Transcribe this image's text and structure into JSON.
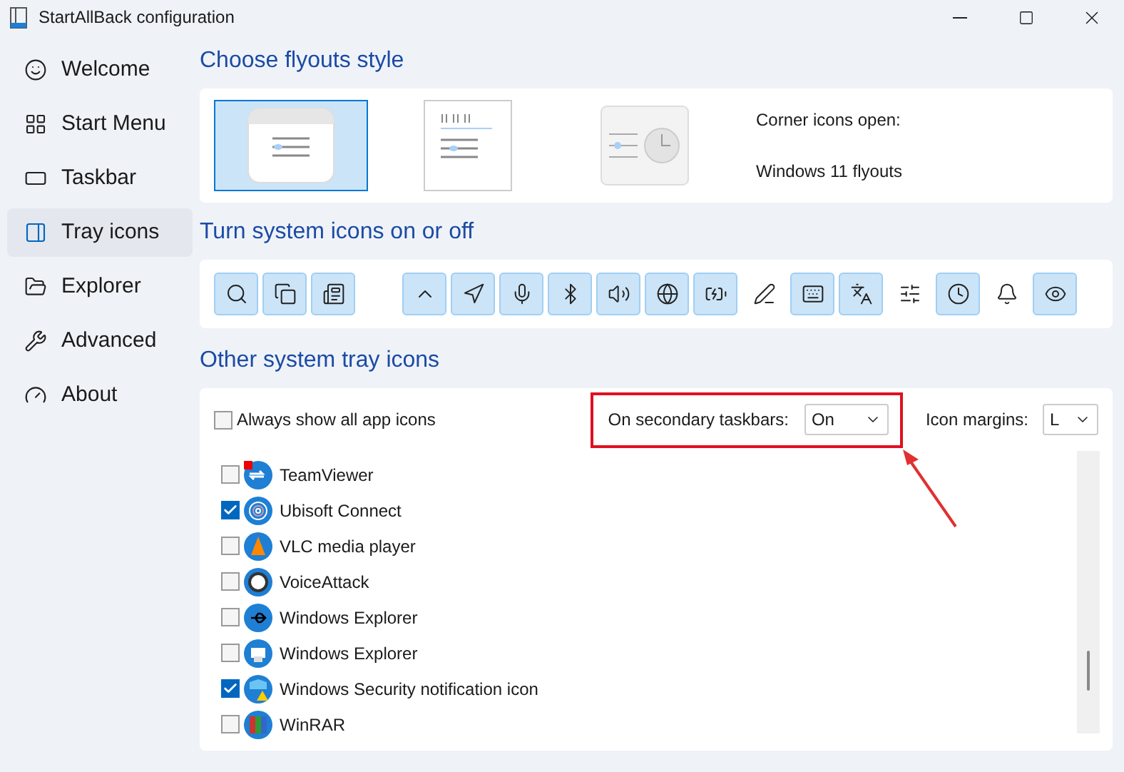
{
  "window": {
    "title": "StartAllBack configuration"
  },
  "sidebar": {
    "items": [
      {
        "label": "Welcome",
        "kind": "smile",
        "selected": false
      },
      {
        "label": "Start Menu",
        "kind": "start",
        "selected": false
      },
      {
        "label": "Taskbar",
        "kind": "taskbar",
        "selected": false
      },
      {
        "label": "Tray icons",
        "kind": "tray",
        "selected": true
      },
      {
        "label": "Explorer",
        "kind": "folder",
        "selected": false
      },
      {
        "label": "Advanced",
        "kind": "wrench",
        "selected": false
      },
      {
        "label": "About",
        "kind": "gauge",
        "selected": false
      }
    ]
  },
  "flyouts": {
    "heading": "Choose flyouts style",
    "styles": [
      {
        "kind": "win11",
        "selected": true
      },
      {
        "kind": "win10",
        "selected": false
      },
      {
        "kind": "win7",
        "selected": false
      }
    ],
    "corner_label": "Corner icons open:",
    "corner_value": "Windows 11 flyouts"
  },
  "system_icons": {
    "heading": "Turn system icons on or off",
    "groups": [
      [
        {
          "kind": "search",
          "on": true
        },
        {
          "kind": "taskview",
          "on": true
        },
        {
          "kind": "widgets",
          "on": true
        }
      ],
      [
        {
          "kind": "chevron",
          "on": true
        },
        {
          "kind": "location",
          "on": true
        },
        {
          "kind": "mic",
          "on": true
        },
        {
          "kind": "bluetooth",
          "on": true
        },
        {
          "kind": "volume",
          "on": true
        },
        {
          "kind": "globe",
          "on": true
        },
        {
          "kind": "battery",
          "on": true
        },
        {
          "kind": "pen",
          "on": false
        },
        {
          "kind": "keyboard",
          "on": true
        },
        {
          "kind": "language",
          "on": true
        },
        {
          "kind": "mixer",
          "on": false
        },
        {
          "kind": "clock",
          "on": true
        },
        {
          "kind": "bell",
          "on": false
        },
        {
          "kind": "eye",
          "on": true
        }
      ]
    ]
  },
  "other_icons": {
    "heading": "Other system tray icons",
    "always_show": {
      "label": "Always show all app icons",
      "checked": false
    },
    "secondary": {
      "label": "On secondary taskbars:",
      "value": "On"
    },
    "margins": {
      "label": "Icon margins:",
      "value": "L"
    },
    "apps": [
      {
        "name": "TeamViewer",
        "kind": "arrows",
        "checked": false
      },
      {
        "name": "Ubisoft Connect",
        "kind": "rings",
        "checked": true
      },
      {
        "name": "VLC media player",
        "kind": "cone",
        "checked": false
      },
      {
        "name": "VoiceAttack",
        "kind": "gear",
        "checked": false
      },
      {
        "name": "Windows Explorer",
        "kind": "usb",
        "checked": false
      },
      {
        "name": "Windows Explorer",
        "kind": "printer",
        "checked": false
      },
      {
        "name": "Windows Security notification icon",
        "kind": "shield",
        "checked": true
      },
      {
        "name": "WinRAR",
        "kind": "books",
        "checked": false
      }
    ]
  }
}
